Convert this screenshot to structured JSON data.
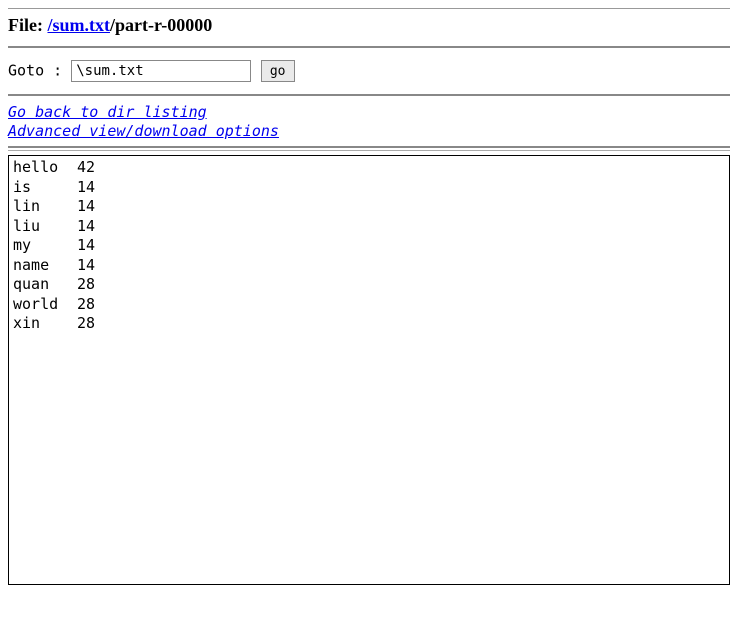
{
  "header": {
    "label_file": "File: ",
    "path_link_text": "/sum.txt",
    "path_suffix": "/part-r-00000"
  },
  "goto": {
    "label": "Goto : ",
    "value": "\\sum.txt",
    "button": "go"
  },
  "links": {
    "back": "Go back to dir listing",
    "advanced": "Advanced view/download options"
  },
  "file_rows": [
    {
      "key": "hello",
      "val": "42"
    },
    {
      "key": "is",
      "val": "14"
    },
    {
      "key": "lin",
      "val": "14"
    },
    {
      "key": "liu",
      "val": "14"
    },
    {
      "key": "my",
      "val": "14"
    },
    {
      "key": "name",
      "val": "14"
    },
    {
      "key": "quan",
      "val": "28"
    },
    {
      "key": "world",
      "val": "28"
    },
    {
      "key": "xin",
      "val": "28"
    }
  ]
}
